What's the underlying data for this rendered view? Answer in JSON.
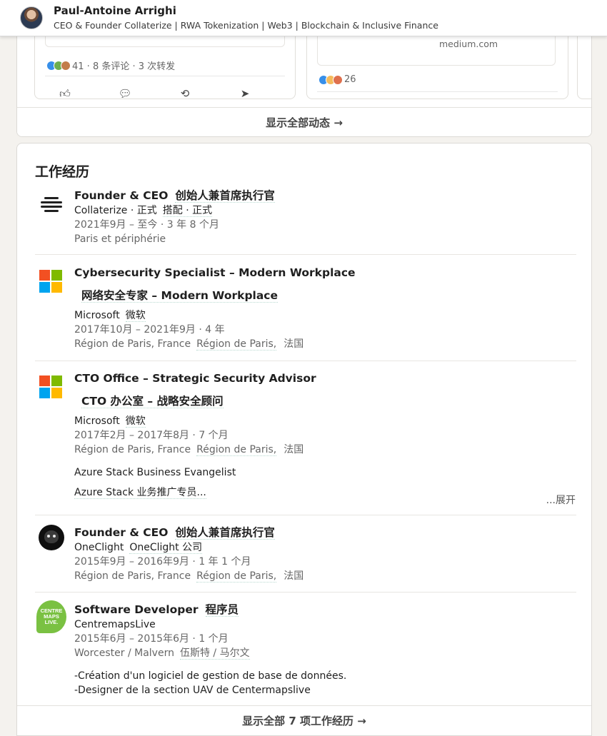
{
  "profile": {
    "name": "Paul-Antoine Arrighi",
    "headline": "CEO & Founder Collaterize | RWA Tokenization | Web3 | Blockchain & Inclusive Finance"
  },
  "activity": {
    "post1": {
      "reactions_text": "41 · 8 条评论 · 3 次转发"
    },
    "post2": {
      "link_host": "medium.com",
      "reactions_text": "26"
    },
    "action_icons": [
      "thumbs-up-icon",
      "comment-icon",
      "repost-icon",
      "send-icon"
    ],
    "show_all": "显示全部动态 →"
  },
  "experience": {
    "heading": "工作经历",
    "items": [
      {
        "title": "Founder & CEO",
        "title_tr": "创始人兼首席执行官",
        "company": "Collaterize · 正式",
        "company_tr": "搭配 · 正式",
        "dates": "2021年9月 – 至今 · 3 年 8 个月",
        "location": "Paris et périphérie",
        "logo": "collaterize-logo"
      },
      {
        "title": "Cybersecurity Specialist – Modern Workplace",
        "title_tr": "网络安全专家 – Modern Workplace",
        "company": "Microsoft",
        "company_tr": "微软",
        "dates": "2017年10月 – 2021年9月 · 4 年",
        "location": "Région de Paris, France",
        "location_tr": "Région de Paris,",
        "location_tr2": "法国",
        "logo": "microsoft-logo"
      },
      {
        "title": "CTO Office – Strategic Security Advisor",
        "title_tr": "CTO 办公室 – 战略安全顾问",
        "company": "Microsoft",
        "company_tr": "微软",
        "dates": "2017年2月 – 2017年8月 · 7 个月",
        "location": "Région de Paris, France",
        "location_tr": "Région de Paris,",
        "location_tr2": "法国",
        "desc": "Azure Stack Business Evangelist",
        "desc_tr": "Azure Stack 业务推广专员...",
        "more": "...展开",
        "logo": "microsoft-logo"
      },
      {
        "title": "Founder & CEO",
        "title_tr": "创始人兼首席执行官",
        "company": "OneClight",
        "company_tr": "OneClight 公司",
        "dates": "2015年9月 – 2016年9月 · 1 年 1 个月",
        "location": "Région de Paris, France",
        "location_tr": "Région de Paris,",
        "location_tr2": "法国",
        "logo": "oneclight-logo"
      },
      {
        "title": "Software Developer",
        "title_tr": "程序员",
        "company": "CentremapsLive",
        "dates": "2015年6月 – 2015年6月 · 1 个月",
        "location": "Worcester / Malvern",
        "location_tr": "伍斯特 / 马尔文",
        "desc1": "-Création d'un logiciel de gestion de base de données.",
        "desc2": "-Designer de la section UAV de Centermapslive",
        "logo": "centremapslive-logo",
        "logo_text": "CENTRE MAPS LIVE."
      }
    ],
    "show_all": "显示全部 7 项工作经历 →"
  }
}
